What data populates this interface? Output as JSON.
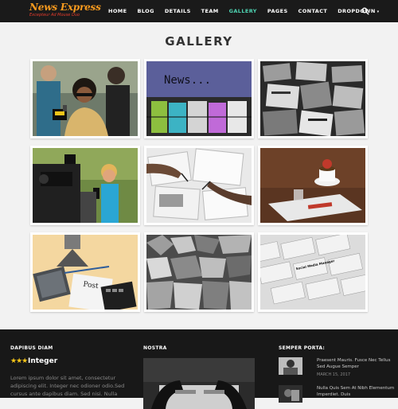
{
  "header": {
    "logo_title": "News Express",
    "logo_tagline": "Excepteur Ad Mouse Duo",
    "nav_items": [
      "HOME",
      "BLOG",
      "DETAILS",
      "TEAM",
      "GALLERY",
      "PAGES",
      "CONTACT",
      "DROPDOWN"
    ],
    "active_item": "GALLERY",
    "accent_color": "#4fd6b4",
    "logo_color": "#f79a1e"
  },
  "page": {
    "title": "GALLERY"
  },
  "gallery": {
    "images": [
      {
        "subject": "reporter-with-microphone"
      },
      {
        "subject": "news-typewriter-text"
      },
      {
        "subject": "stack-of-newspapers"
      },
      {
        "subject": "tv-reporter-and-cameraman"
      },
      {
        "subject": "hands-drawing-on-papers"
      },
      {
        "subject": "coffee-and-newspaper"
      },
      {
        "subject": "post-newspaper-desk"
      },
      {
        "subject": "crumpled-newspapers"
      },
      {
        "subject": "social-media-manager-newspapers"
      }
    ],
    "text_news": "News...",
    "text_post": "Post",
    "text_social": "Social Media Manager"
  },
  "footer": {
    "col1_heading": "DAPIBUS DIAM",
    "col1_stars": "★★★",
    "col1_title": "Integer",
    "col1_text": "Lorem ipsum dolor sit amet, consectetur adipiscing elit. Integer nec odioner odio.Sed cursus ante dapibus diam. Sed nisi. Nulla",
    "col2_heading": "NOSTRA",
    "col3_heading": "SEMPER PORTA:",
    "posts": [
      {
        "title": "Praesent Mauris. Fusce Nec Tellus Sed Augue Semper",
        "date": "MARCH 15, 2017"
      },
      {
        "title": "Nulla Quis Sem At Nibh Elementum Imperdiet. Duis",
        "date": ""
      }
    ]
  }
}
